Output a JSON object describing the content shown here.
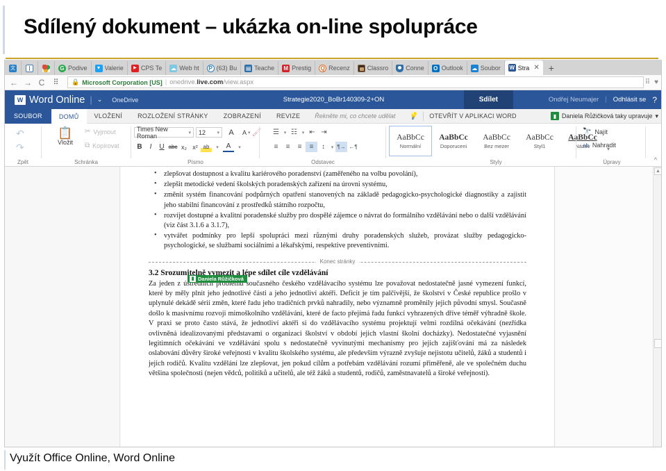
{
  "slide": {
    "title": "Sdílený dokument – ukázka on-line spolupráce",
    "caption": "Využít Office Online, Word Online",
    "accent_gold": "#c9a227"
  },
  "browser": {
    "pinned_tabs": [
      {
        "icon": "translate-icon",
        "label": ""
      },
      {
        "icon": "layout-icon",
        "label": ""
      },
      {
        "icon": "color-palette-icon",
        "label": ""
      }
    ],
    "tabs": [
      {
        "icon": "green-circle-icon",
        "label": "Podive"
      },
      {
        "icon": "twitter-icon",
        "label": "Valerie"
      },
      {
        "icon": "youtube-icon",
        "label": "CPS Te"
      },
      {
        "icon": "cloud-icon",
        "label": "Web ht"
      },
      {
        "icon": "pocket-icon",
        "label": "(63) Bu"
      },
      {
        "icon": "teacher-icon",
        "label": "Teache"
      },
      {
        "icon": "m-red-icon",
        "label": "Prestig"
      },
      {
        "icon": "search-circle-icon",
        "label": "Recenz"
      },
      {
        "icon": "photo-icon",
        "label": "Classro"
      },
      {
        "icon": "shield-icon",
        "label": "Conne"
      },
      {
        "icon": "outlook-icon",
        "label": "Outlook"
      },
      {
        "icon": "onedrive-icon",
        "label": "Soubor"
      },
      {
        "icon": "word-icon",
        "label": "Stra",
        "active": true
      }
    ],
    "new_tab_label": "+",
    "close_label": "✕",
    "nav": {
      "back": "←",
      "forward": "→",
      "reload": "C",
      "apps": "⠿"
    },
    "url": {
      "lock": "🔒",
      "ev_name": "Microsoft Corporation [US]",
      "separator": "|",
      "prefix": "onedrive.",
      "domain": "live.com",
      "path": "/view.aspx"
    },
    "right_icons": [
      "apps-grid-icon",
      "heart-icon"
    ]
  },
  "word_online": {
    "logo_letter": "W",
    "app_title": "Word Online",
    "caret": "⌄",
    "location": "OneDrive",
    "document_name": "Strategie2020_BoBr140309-2+ON",
    "share_label": "Sdílet",
    "user_name": "Ondřej Neumajer",
    "sign_out_label": "Odhlásit se",
    "help_label": "?",
    "ribbon_tabs": [
      {
        "label": "SOUBOR",
        "kind": "file"
      },
      {
        "label": "DOMŮ",
        "selected": true
      },
      {
        "label": "VLOŽENÍ"
      },
      {
        "label": "ROZLOŽENÍ STRÁNKY"
      },
      {
        "label": "ZOBRAZENÍ"
      },
      {
        "label": "REVIZE"
      }
    ],
    "tell_me_placeholder": "Řekněte mi, co chcete udělat",
    "open_in_word_label": "OTEVŘÍT V APLIKACI WORD",
    "coeditor": {
      "avatar_glyph": "👤",
      "text": "Daniela Růžičková taky upravuje",
      "caret": "▾",
      "color": "#1e8e3e"
    },
    "ribbon": {
      "groups": [
        {
          "name": "Zpět",
          "label": "Zpět"
        },
        {
          "name": "Schránka",
          "label": "Schránka"
        },
        {
          "name": "Písmo",
          "label": "Písmo"
        },
        {
          "name": "Odstavec",
          "label": "Odstavec"
        },
        {
          "name": "Styly",
          "label": "Styly"
        },
        {
          "name": "Úpravy",
          "label": "Úpravy"
        }
      ],
      "undo_glyph": "↶",
      "redo_glyph": "↷",
      "paste_label": "Vložit",
      "cut_label": "Vyjmout",
      "copy_label": "Kopírovat",
      "font_name": "Times New Roman",
      "font_size": "12",
      "grow_font": "A",
      "shrink_font": "A",
      "bold": "B",
      "italic": "I",
      "underline": "U",
      "strike": "abc",
      "subscript": "x₂",
      "superscript": "x²",
      "highlight": "ab",
      "font_color": "A",
      "format_painter": "🖌",
      "bullets": "☰",
      "numbering": "☷",
      "decrease_indent": "⇤",
      "increase_indent": "⇥",
      "align_left": "≡",
      "align_center": "≡",
      "align_right": "≡",
      "align_justify": "≡",
      "line_spacing": "↕",
      "ltr": "¶→",
      "rtl": "←¶",
      "styles": [
        {
          "preview": "AaBbCc",
          "name": "Normální",
          "selected": true,
          "style": "normal"
        },
        {
          "preview": "AaBbCc",
          "name": "Doporuceni",
          "style": "bold"
        },
        {
          "preview": "AaBbCc",
          "name": "Bez mezer",
          "style": "normal"
        },
        {
          "preview": "AaBbCc",
          "name": "Styl1",
          "style": "normal"
        },
        {
          "preview": "AaBbCc",
          "name": "Název",
          "style": "bold-underline"
        }
      ],
      "styles_more": "▾",
      "find_label": "Najít",
      "replace_label": "Nahradit",
      "find_icon": "binoculars-icon",
      "replace_icon": "replace-icon",
      "collapse_icon": "^"
    }
  },
  "document": {
    "bullets": [
      "zlepšovat dostupnost a kvalitu kariérového poradenství (zaměřeného na volbu povolání),",
      "zlepšit metodické vedení školských poradenských zařízení na úrovni systému,",
      "změnit systém financování podpůrných opatření stanovených na základě pedagogicko-psychologické diagnostiky a zajistit jeho stabilní financování z prostředků státního rozpočtu,",
      "rozvíjet dostupné a kvalitní poradenské služby pro dospělé zájemce o návrat do formálního vzdělávání nebo o další vzdělávání (viz část 3.1.6 a 3.1.7),",
      "vytvářet podmínky pro lepší spolupráci mezi různými druhy poradenských služeb, provázat služby pedagogicko-psychologické, se službami sociálními a lékařskými, respektive preventivními."
    ],
    "page_break_label": "Konec stránky",
    "heading": "3.2 Srozumitelně vymezit a lépe sdílet cíle vzdělávání",
    "collaborator_tag": "Daniela Růžičková",
    "paragraph": "Za jeden z ústředních problémů současného českého vzdělávacího systému lze považovat nedostatečně jasné vymezení funkcí, které by měly plnit jeho jednotlivé části a jeho jednotliví aktéři. Deficit je tím palčivější, že školství v České republice prošlo v uplynulé dekádě sérií změn, které řadu jeho tradičních prvků nahradily, nebo významně proměnily jejich původní smysl. Současně došlo k masivnímu rozvoji mimoškolního vzdělávání, které de facto přejímá řadu funkcí vyhrazených dříve téměř výhradně škole. V praxi se proto často stává, že jednotliví aktéři si do vzdělávacího systému projektují velmi rozdílná očekávání (nezřídka ovlivněná idealizovanými představami o organizaci školství v období jejich vlastní školní docházky). Nedostatečné vyjasnění legitimních očekávání ve vzdělávání spolu s nedostatečně vyvinutými mechanismy pro jejich zajišťování má za následek oslabování důvěry široké veřejnosti v kvalitu školského systému, ale především výrazně zvyšuje nejistotu učitelů, žáků a studentů i jejich rodičů. Kvalitu vzdělání lze zlepšovat, jen pokud cílům a potřebám vzdělávání rozumí přiměřeně, ale ve společném duchu většina společnosti (nejen vědců, politiků a učitelů, ale též žáků a studentů, rodičů, zaměstnavatelů a široké veřejnosti)."
  }
}
